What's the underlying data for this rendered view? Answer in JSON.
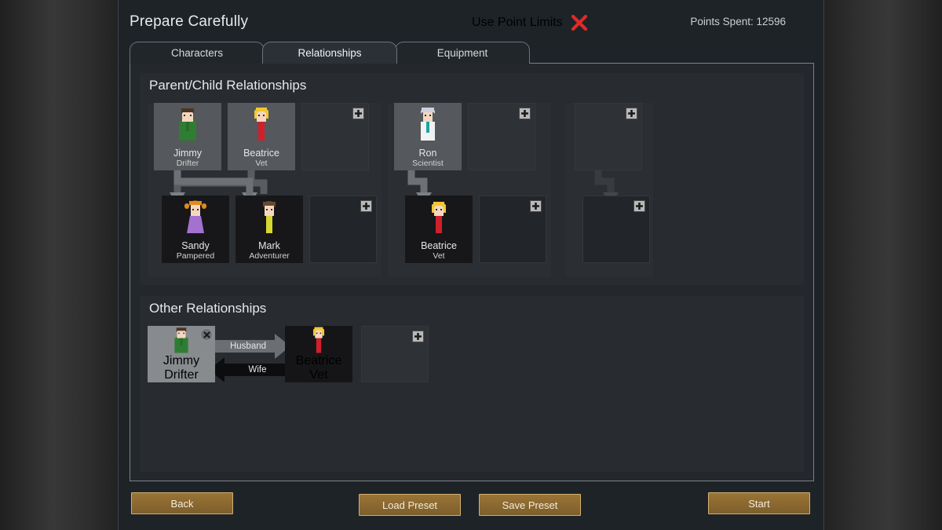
{
  "window": {
    "title": "Prepare Carefully"
  },
  "header": {
    "point_limits_label": "Use Point Limits",
    "point_limits_icon": "red-x-icon",
    "point_limits_enabled": false,
    "points_spent": "Points Spent: 12596",
    "accent_red": "#e02a26"
  },
  "tabs": [
    {
      "label": "Characters",
      "active": false
    },
    {
      "label": "Relationships",
      "active": true
    },
    {
      "label": "Equipment",
      "active": false
    }
  ],
  "sections": {
    "parent_child": {
      "title": "Parent/Child Relationships",
      "groups": [
        {
          "parents": [
            {
              "name": "Jimmy",
              "role": "Drifter",
              "hair": "#4a3627",
              "body": "#2e7d32",
              "skin": "#f5d7c0"
            },
            {
              "name": "Beatrice",
              "role": "Vet",
              "hair": "#f2c832",
              "body": "#d0202a",
              "skin": "#f5d7c0"
            }
          ],
          "parent_add_slots": 1,
          "children": [
            {
              "name": "Sandy",
              "role": "Pampered",
              "hair": "#e08a1e",
              "body": "#a471cf",
              "skin": "#f5d7c0"
            },
            {
              "name": "Mark",
              "role": "Adventurer",
              "hair": "#6b4a2c",
              "body": "#d8d630",
              "skin": "#f5d7c0"
            }
          ],
          "child_add_slots": 1
        },
        {
          "parents": [
            {
              "name": "Ron",
              "role": "Scientist",
              "hair": "#cfcfdd",
              "body": "#f2f2f2",
              "skin": "#f5d7c0",
              "accent": "#1aa3a3"
            }
          ],
          "parent_add_slots": 1,
          "children": [
            {
              "name": "Beatrice",
              "role": "Vet",
              "hair": "#f2c832",
              "body": "#d0202a",
              "skin": "#f5d7c0"
            }
          ],
          "child_add_slots": 1
        },
        {
          "parents": [],
          "parent_add_slots": 1,
          "children": [],
          "child_add_slots": 1
        }
      ]
    },
    "other": {
      "title": "Other Relationships",
      "pairs": [
        {
          "left": {
            "name": "Jimmy",
            "role": "Drifter",
            "hair": "#4a3627",
            "body": "#2e7d32",
            "skin": "#f5d7c0"
          },
          "right": {
            "name": "Beatrice",
            "role": "Vet",
            "hair": "#f2c832",
            "body": "#d0202a",
            "skin": "#f5d7c0"
          },
          "forward_label": "Husband",
          "reverse_label": "Wife",
          "removable": true
        }
      ],
      "add_slots": 1
    }
  },
  "buttons": {
    "back": "Back",
    "load_preset": "Load Preset",
    "save_preset": "Save Preset",
    "start": "Start"
  },
  "icons": {
    "plus": "plus-icon",
    "close": "close-x-icon"
  }
}
